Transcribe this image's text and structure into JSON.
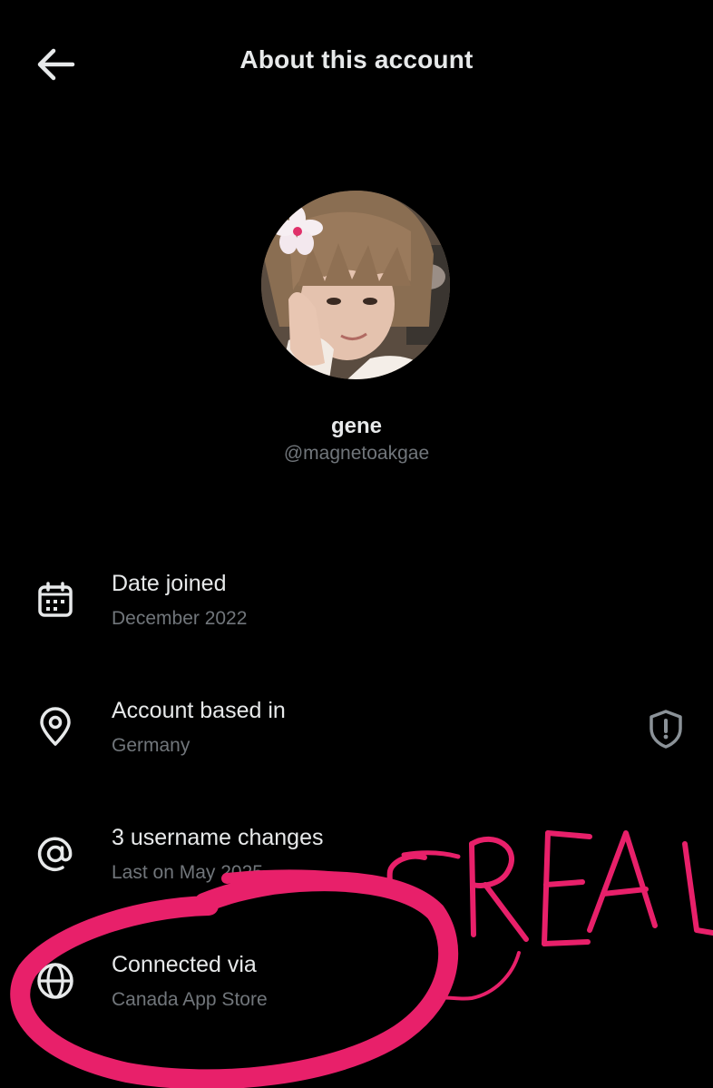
{
  "header": {
    "title": "About this account",
    "back_icon": "arrow-left-icon"
  },
  "profile": {
    "display_name": "gene",
    "handle": "@magnetoakgae"
  },
  "details": [
    {
      "icon": "calendar-icon",
      "title": "Date joined",
      "value": "December 2022"
    },
    {
      "icon": "location-pin-icon",
      "title": "Account based in",
      "value": "Germany",
      "badge_icon": "shield-alert-icon"
    },
    {
      "icon": "at-sign-icon",
      "title": "3 username changes",
      "value": "Last on May 2025"
    },
    {
      "icon": "globe-icon",
      "title": "Connected via",
      "value": "Canada App Store"
    }
  ],
  "annotation": {
    "text": "REAL",
    "color": "#e8206a"
  },
  "colors": {
    "background": "#000000",
    "primary_text": "#e7e9ea",
    "secondary_text": "#71767b"
  }
}
